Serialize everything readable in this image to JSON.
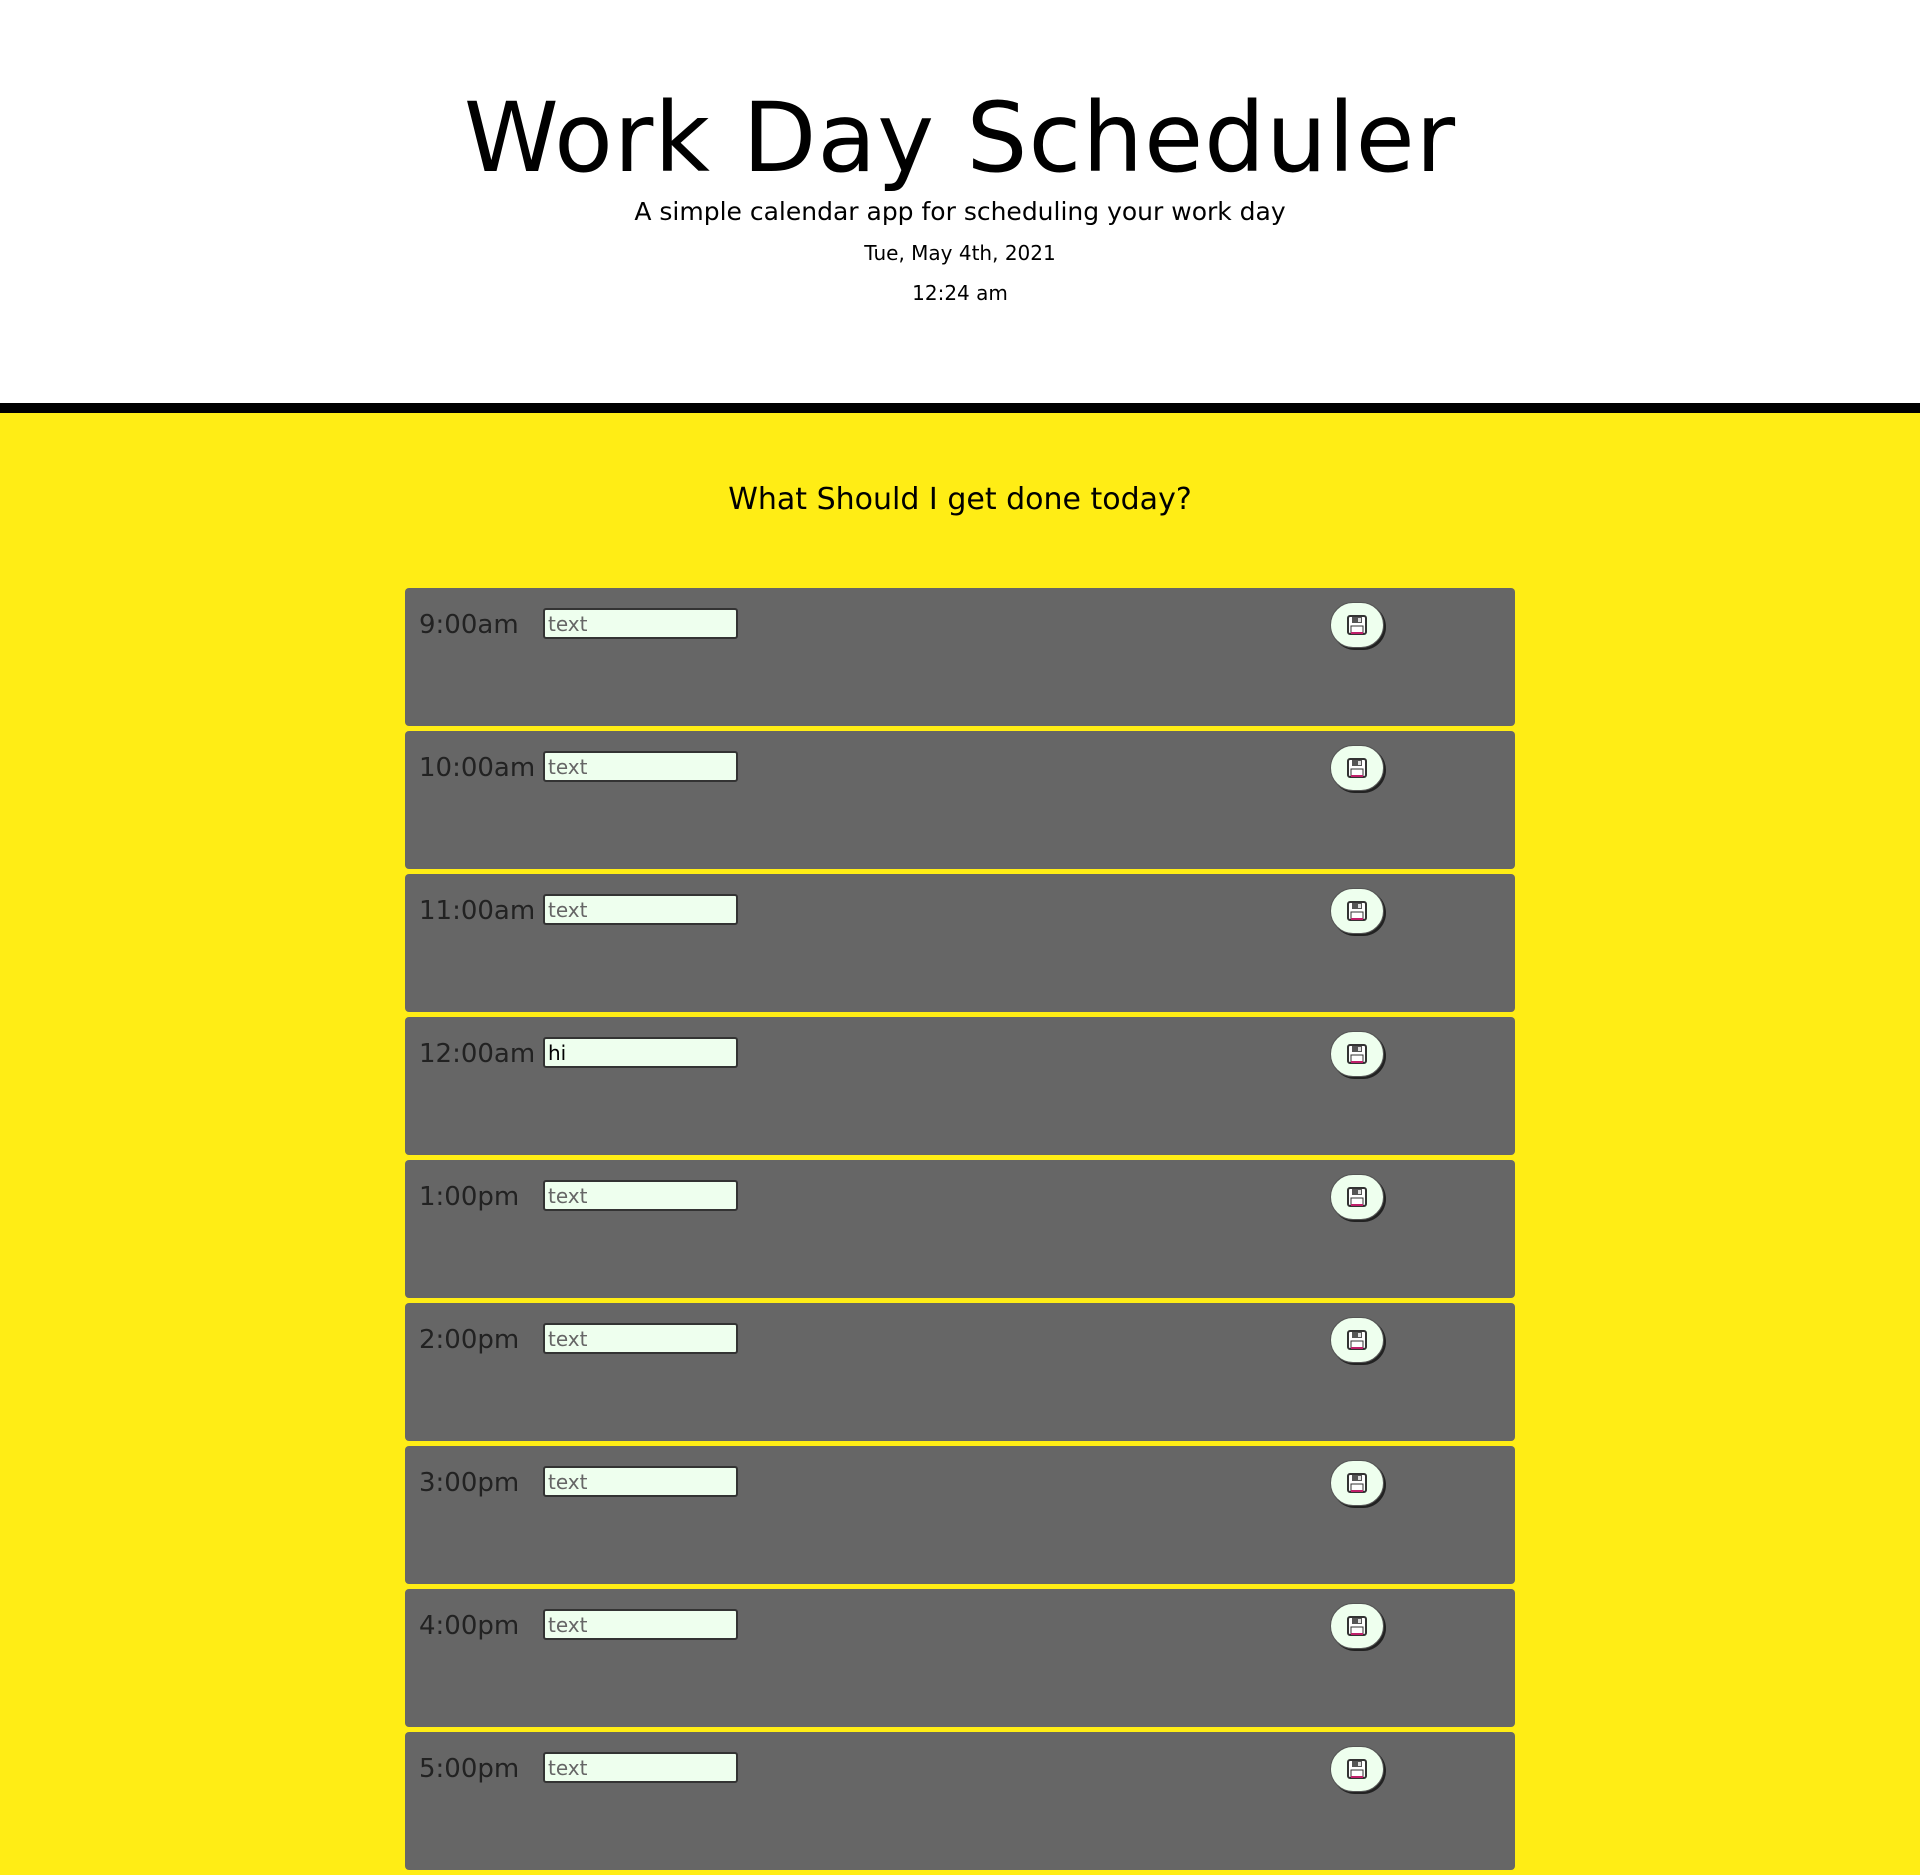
{
  "header": {
    "title": "Work Day Scheduler",
    "subtitle": "A simple calendar app for scheduling your work day",
    "date": "Tue, May 4th, 2021",
    "time": "12:24 am"
  },
  "prompt": "What Should I get done today?",
  "colors": {
    "background": "#ffed15",
    "header": "#ffffff",
    "divider": "#000000",
    "row": "#666666",
    "input": "#eeffee"
  },
  "save_icon": "floppy-disk-icon",
  "slots": [
    {
      "hour": "9:00am",
      "value": "",
      "placeholder": "text"
    },
    {
      "hour": "10:00am",
      "value": "",
      "placeholder": "text"
    },
    {
      "hour": "11:00am",
      "value": "",
      "placeholder": "text"
    },
    {
      "hour": "12:00am",
      "value": "hi",
      "placeholder": "text"
    },
    {
      "hour": "1:00pm",
      "value": "",
      "placeholder": "text"
    },
    {
      "hour": "2:00pm",
      "value": "",
      "placeholder": "text"
    },
    {
      "hour": "3:00pm",
      "value": "",
      "placeholder": "text"
    },
    {
      "hour": "4:00pm",
      "value": "",
      "placeholder": "text"
    },
    {
      "hour": "5:00pm",
      "value": "",
      "placeholder": "text"
    }
  ]
}
